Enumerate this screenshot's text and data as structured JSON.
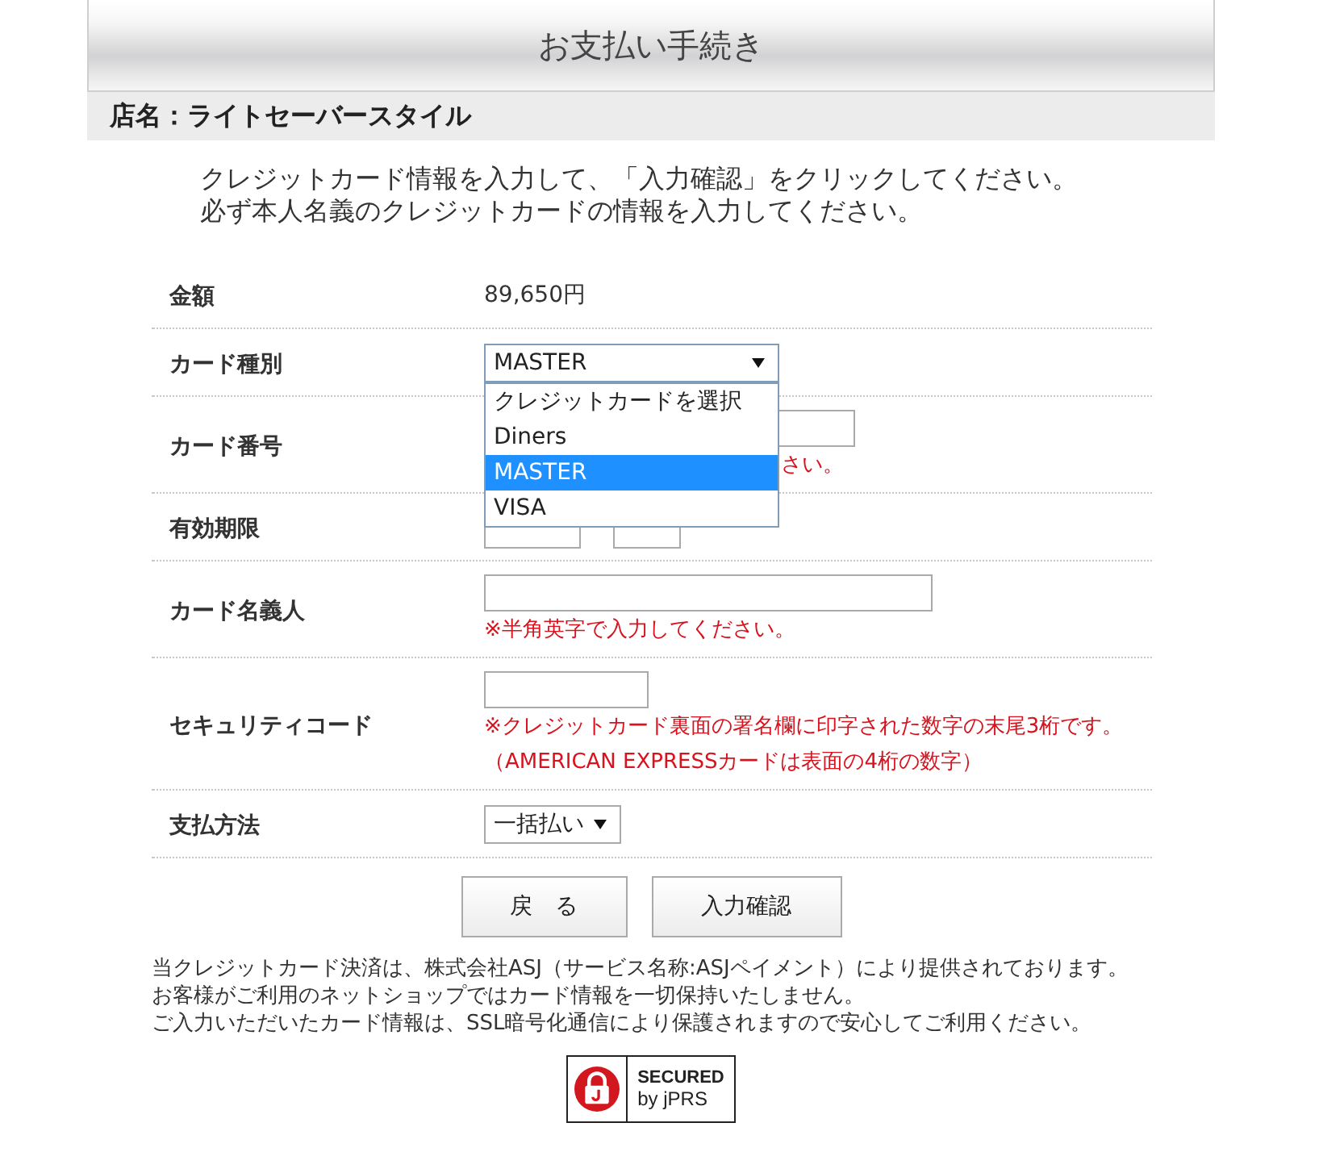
{
  "header": {
    "title": "お支払い手続き"
  },
  "shop": {
    "label": "店名：ライトセーバースタイル"
  },
  "instructions": [
    "クレジットカード情報を入力して、「入力確認」をクリックしてください。",
    "必ず本人名義のクレジットカードの情報を入力してください。"
  ],
  "form": {
    "rows": [
      {
        "kind": "text",
        "label": "金額",
        "value": "89,650円"
      },
      {
        "kind": "select",
        "label": "カード種別",
        "value": "MASTER",
        "expanded": true,
        "options": [
          {
            "label": "クレジットカードを選択",
            "selected": false
          },
          {
            "label": "Diners",
            "selected": false
          },
          {
            "label": "MASTER",
            "selected": true
          },
          {
            "label": "VISA",
            "selected": false
          }
        ]
      },
      {
        "kind": "input",
        "label": "カード番号",
        "notes": [
          "さい。"
        ]
      },
      {
        "kind": "expiry",
        "label": "有効期限"
      },
      {
        "kind": "input",
        "label": "カード名義人",
        "notes": [
          "※半角英字で入力してください。"
        ]
      },
      {
        "kind": "input",
        "label": "セキュリティコード",
        "notes": [
          "※クレジットカード裏面の署名欄に印字された数字の末尾3桁です。",
          "（AMERICAN EXPRESSカードは表面の4桁の数字）"
        ]
      },
      {
        "kind": "select",
        "label": "支払方法",
        "value": "一括払い",
        "expanded": false
      }
    ]
  },
  "buttons": [
    {
      "label": "戻　る"
    },
    {
      "label": "入力確認"
    }
  ],
  "notice": [
    "当クレジットカード決済は、株式会社ASJ（サービス名称:ASJペイメント）により提供されております。",
    "お客様がご利用のネットショップではカード情報を一切保持いたしません。",
    "ご入力いただいたカード情報は、SSL暗号化通信により保護されますので安心してご利用ください。"
  ],
  "seal": {
    "line_1": "SECURED",
    "line_2": "by jPRS"
  }
}
